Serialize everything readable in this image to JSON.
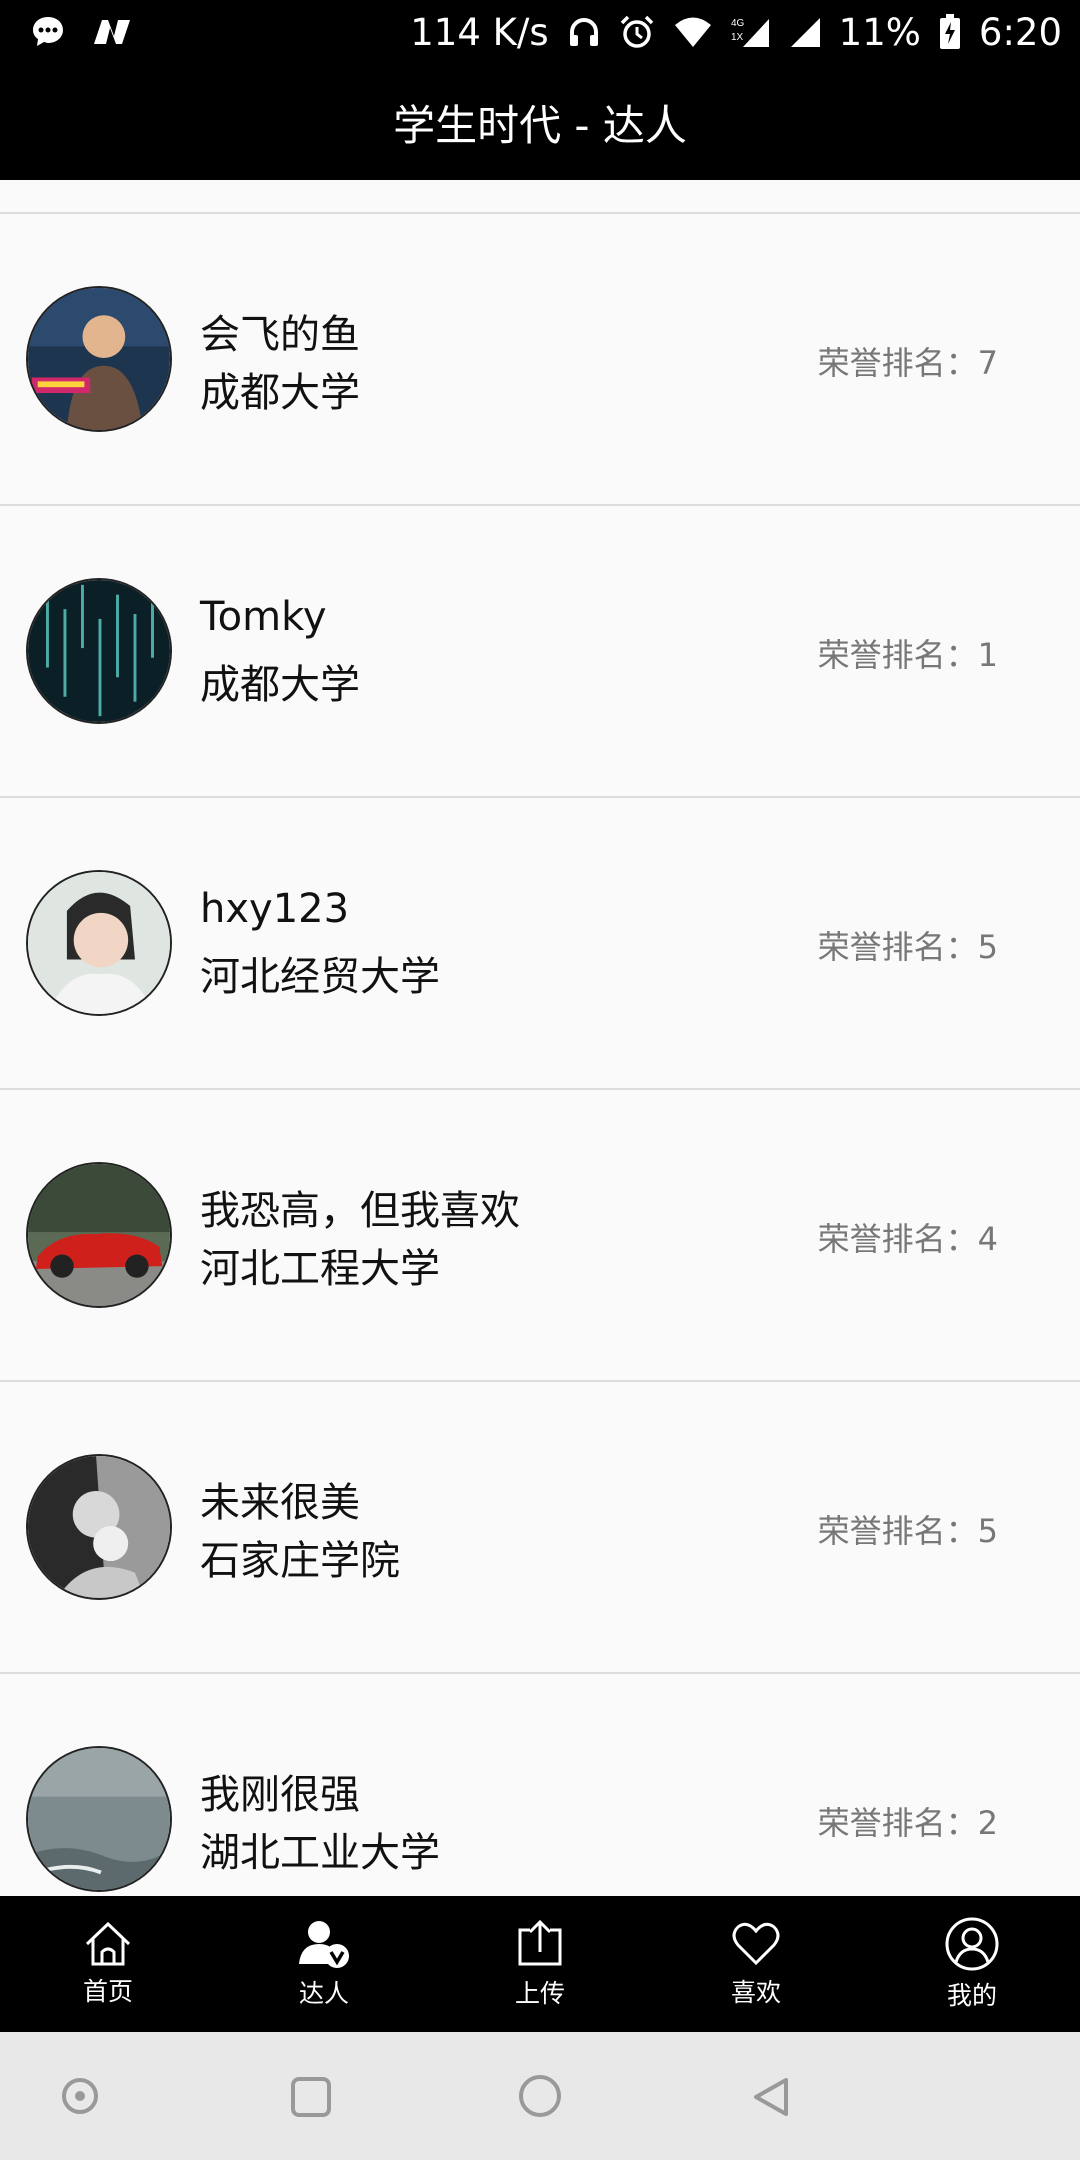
{
  "status_bar": {
    "speed": "114 K/s",
    "network": "4G 1X",
    "battery": "11%",
    "time": "6:20"
  },
  "header": {
    "title": "学生时代 - 达人"
  },
  "rows": [
    {
      "name": "会飞的鱼",
      "school": "成都大学",
      "rank": "荣誉排名：7"
    },
    {
      "name": "Tomky",
      "school": "成都大学",
      "rank": "荣誉排名：1"
    },
    {
      "name": "hxy123",
      "school": "河北经贸大学",
      "rank": "荣誉排名：5"
    },
    {
      "name": "我恐高，但我喜欢",
      "school": "河北工程大学",
      "rank": "荣誉排名：4"
    },
    {
      "name": "未来很美",
      "school": "石家庄学院",
      "rank": "荣誉排名：5"
    },
    {
      "name": "我刚很强",
      "school": "湖北工业大学",
      "rank": "荣誉排名：2"
    }
  ],
  "tabs": [
    {
      "label": "首页",
      "icon": "home-icon"
    },
    {
      "label": "达人",
      "icon": "expert-icon"
    },
    {
      "label": "上传",
      "icon": "upload-icon"
    },
    {
      "label": "喜欢",
      "icon": "heart-icon"
    },
    {
      "label": "我的",
      "icon": "profile-icon"
    }
  ]
}
